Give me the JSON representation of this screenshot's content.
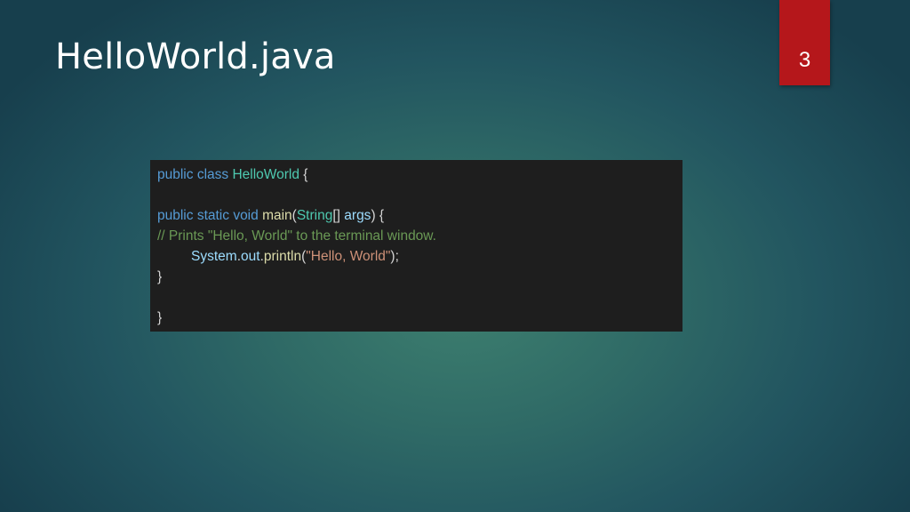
{
  "slide": {
    "title": "HelloWorld.java",
    "page_number": "3"
  },
  "code": {
    "line1": {
      "kw1": "public",
      "kw2": "class",
      "class_name": "HelloWorld",
      "brace": "{"
    },
    "line2": {
      "kw1": "public",
      "kw2": "static",
      "kw3": "void",
      "method": "main",
      "paren_open": "(",
      "param_type": "String",
      "brackets": "[]",
      "param_name": "args",
      "paren_close_brace": ") {"
    },
    "line3": {
      "comment": "// Prints \"Hello, World\" to the terminal window."
    },
    "line4": {
      "system": "System",
      "dot1": ".",
      "out": "out",
      "dot2": ".",
      "println": "println",
      "paren_open": "(",
      "string": "\"Hello, World\"",
      "end": ");"
    },
    "line5": {
      "brace": "}"
    },
    "line6": {
      "brace": "}"
    }
  },
  "colors": {
    "background": "#2f6a66",
    "page_tab": "#b5171b",
    "code_background": "#1e1e1e",
    "keyword": "#569cd6",
    "type": "#4ec9b0",
    "function": "#dcdcaa",
    "parameter": "#9cdcfe",
    "string": "#ce9178",
    "comment": "#6a9955"
  }
}
